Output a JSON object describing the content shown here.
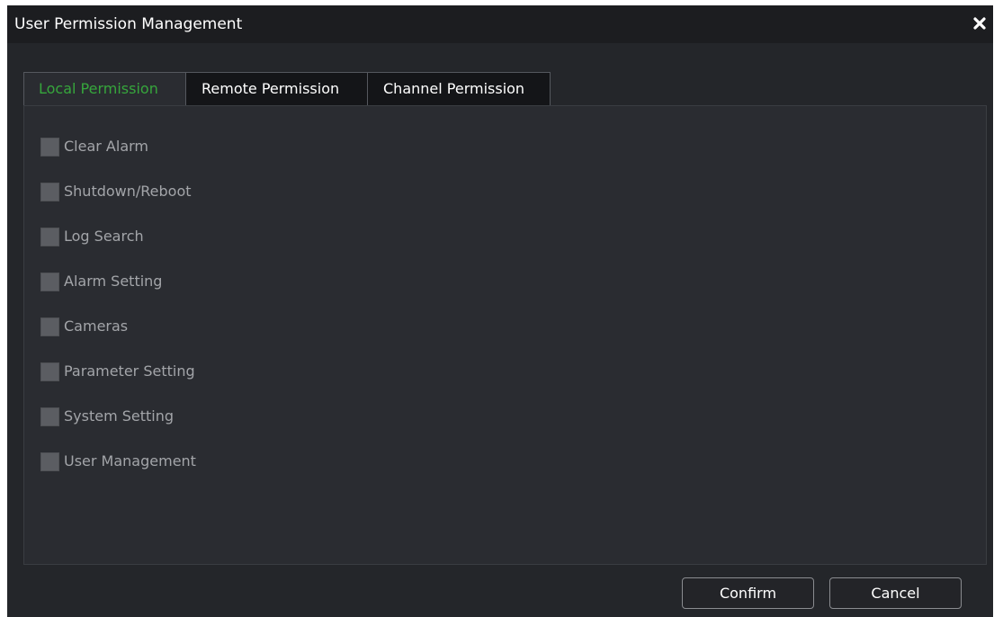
{
  "dialog": {
    "title": "User Permission Management",
    "close_icon": "close-x-icon"
  },
  "tabs": [
    {
      "label": "Local Permission",
      "active": true
    },
    {
      "label": "Remote Permission",
      "active": false
    },
    {
      "label": "Channel Permission",
      "active": false
    }
  ],
  "permissions": [
    {
      "label": "Clear Alarm",
      "checked": false
    },
    {
      "label": "Shutdown/Reboot",
      "checked": false
    },
    {
      "label": "Log Search",
      "checked": false
    },
    {
      "label": "Alarm Setting",
      "checked": false
    },
    {
      "label": "Cameras",
      "checked": false
    },
    {
      "label": "Parameter Setting",
      "checked": false
    },
    {
      "label": "System Setting",
      "checked": false
    },
    {
      "label": "User Management",
      "checked": false
    }
  ],
  "buttons": {
    "confirm_label": "Confirm",
    "cancel_label": "Cancel"
  },
  "colors": {
    "dialog_bg": "#24262a",
    "titlebar_bg": "#1c1d20",
    "active_tab_text": "#36a63c",
    "checkbox_fill": "#5b5d62",
    "label_text": "#a3a5a9"
  }
}
